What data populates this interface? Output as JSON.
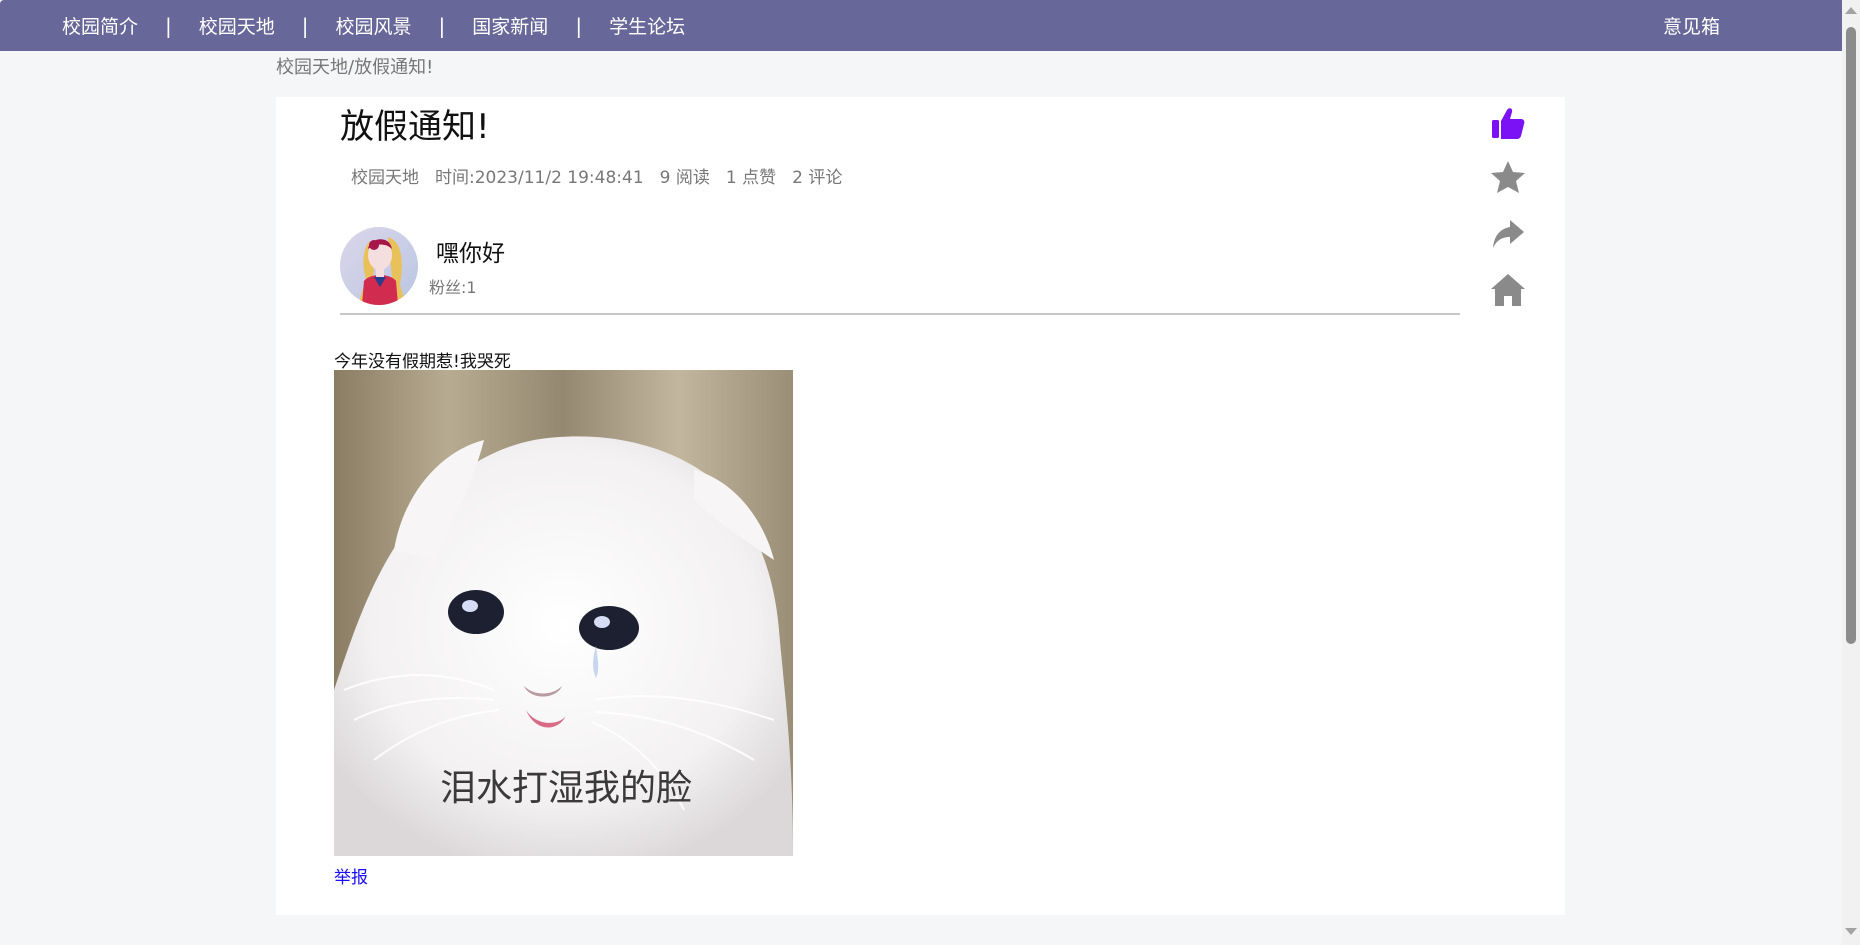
{
  "nav": {
    "items": [
      "校园简介",
      "校园天地",
      "校园风景",
      "国家新闻",
      "学生论坛"
    ],
    "separator": "|",
    "feedback": "意见箱"
  },
  "breadcrumb": "校园天地/放假通知!",
  "post": {
    "title": "放假通知!",
    "meta": {
      "category": "校园天地",
      "time": "时间:2023/11/2 19:48:41",
      "reads": "9 阅读",
      "likes": "1 点赞",
      "comments": "2 评论"
    },
    "author": {
      "name": "嘿你好",
      "fans": "粉丝:1"
    },
    "content": "今年没有假期惹!我哭死",
    "image_caption": "泪水打湿我的脸",
    "report": "举报"
  },
  "actions": {
    "icons": [
      "thumbs-up-icon",
      "star-icon",
      "share-icon",
      "home-icon"
    ],
    "like_color": "#7b12f5",
    "inactive_color": "#8a8a8a"
  },
  "colors": {
    "nav_bg": "#676799",
    "page_bg": "#f5f6f8",
    "link": "#1a0dff"
  }
}
